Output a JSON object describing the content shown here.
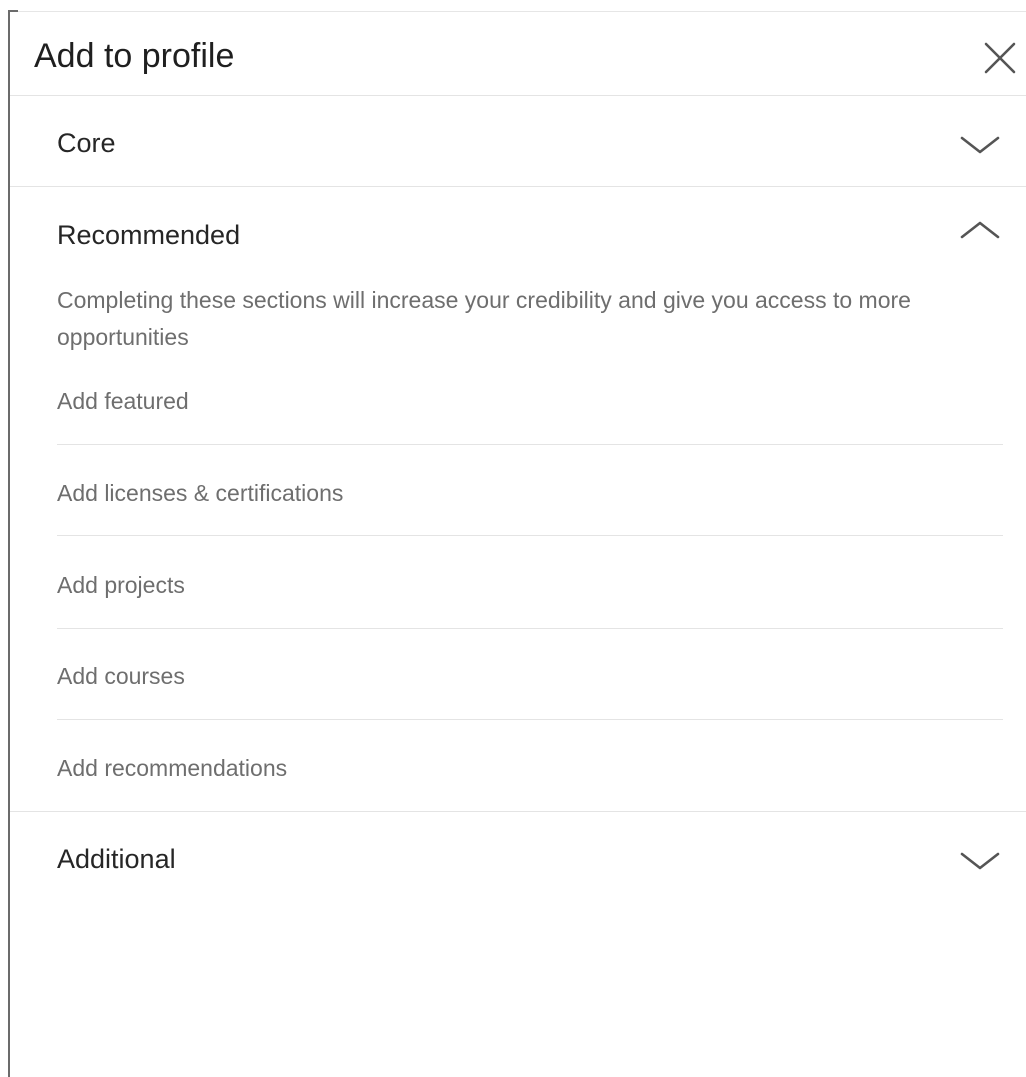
{
  "dialog": {
    "title": "Add to profile",
    "close_label": "Close"
  },
  "sections": {
    "core": {
      "title": "Core",
      "expanded": false
    },
    "recommended": {
      "title": "Recommended",
      "expanded": true,
      "description": "Completing these sections will increase your credibility and give you access to more opportunities",
      "items": [
        {
          "label": "Add featured"
        },
        {
          "label": "Add licenses & certifications"
        },
        {
          "label": "Add projects"
        },
        {
          "label": "Add courses"
        },
        {
          "label": "Add recommendations"
        }
      ]
    },
    "additional": {
      "title": "Additional",
      "expanded": false
    }
  },
  "icons": {
    "close": "close-icon",
    "collapsed": "chevron-down-icon",
    "expanded": "chevron-up-icon"
  },
  "colors": {
    "title_text": "#1f1f1f",
    "section_text": "#262626",
    "muted_text": "#6e6e6e",
    "divider": "#e4e4e4",
    "icon": "#555555"
  }
}
